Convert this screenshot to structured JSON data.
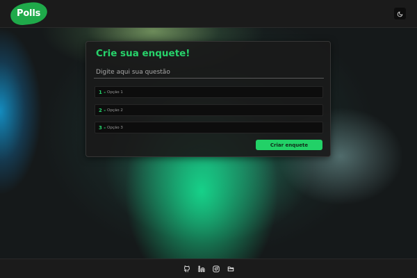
{
  "header": {
    "logo_text": "Polls",
    "theme_toggle_icon": "moon-icon"
  },
  "poll_form": {
    "title": "Crie sua enquete!",
    "question_placeholder": "Digite aqui sua questão",
    "options": [
      {
        "number": "1 -",
        "placeholder": "Opção 1"
      },
      {
        "number": "2 -",
        "placeholder": "Opção 2"
      },
      {
        "number": "3 -",
        "placeholder": "Opção 3"
      }
    ],
    "submit_label": "Criar enquete"
  },
  "footer": {
    "icons": [
      "github-icon",
      "linkedin-icon",
      "instagram-icon",
      "folder-icon"
    ]
  },
  "colors": {
    "accent": "#27d36b",
    "button": "#22d167",
    "logo": "#1faa4a",
    "surface": "#1b1b1b"
  }
}
